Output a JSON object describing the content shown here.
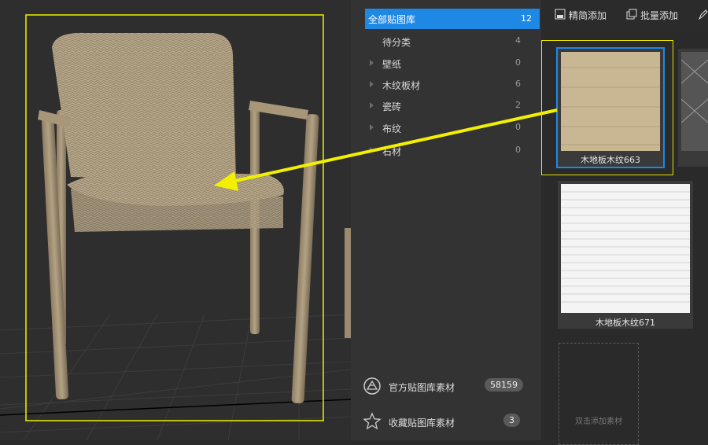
{
  "categories": {
    "all": {
      "label": "全部贴图库",
      "count": "12"
    },
    "items": [
      {
        "label": "待分类",
        "count": "4",
        "expandable": false
      },
      {
        "label": "壁纸",
        "count": "0",
        "expandable": true
      },
      {
        "label": "木纹板材",
        "count": "6",
        "expandable": true
      },
      {
        "label": "瓷砖",
        "count": "2",
        "expandable": true
      },
      {
        "label": "布纹",
        "count": "0",
        "expandable": true
      },
      {
        "label": "石材",
        "count": "0",
        "expandable": true
      }
    ]
  },
  "toolbar": {
    "precise_add": "精简添加",
    "batch_add": "批量添加"
  },
  "materials": [
    {
      "name": "木地板木纹663",
      "selected": true
    },
    {
      "name": "木地板木纹671",
      "selected": false
    }
  ],
  "add_material": "双击添加素材",
  "bottom": {
    "official": {
      "label": "官方贴图库素材",
      "count": "58159"
    },
    "favorites": {
      "label": "收藏贴图库素材",
      "count": "3"
    }
  },
  "colors": {
    "accent": "#1e88e5",
    "highlight": "#f0f000",
    "selection_border": "#e8e200"
  },
  "icons": [
    "precise-add-icon",
    "batch-add-icon",
    "expand-arrow-icon",
    "official-library-icon",
    "star-icon"
  ]
}
